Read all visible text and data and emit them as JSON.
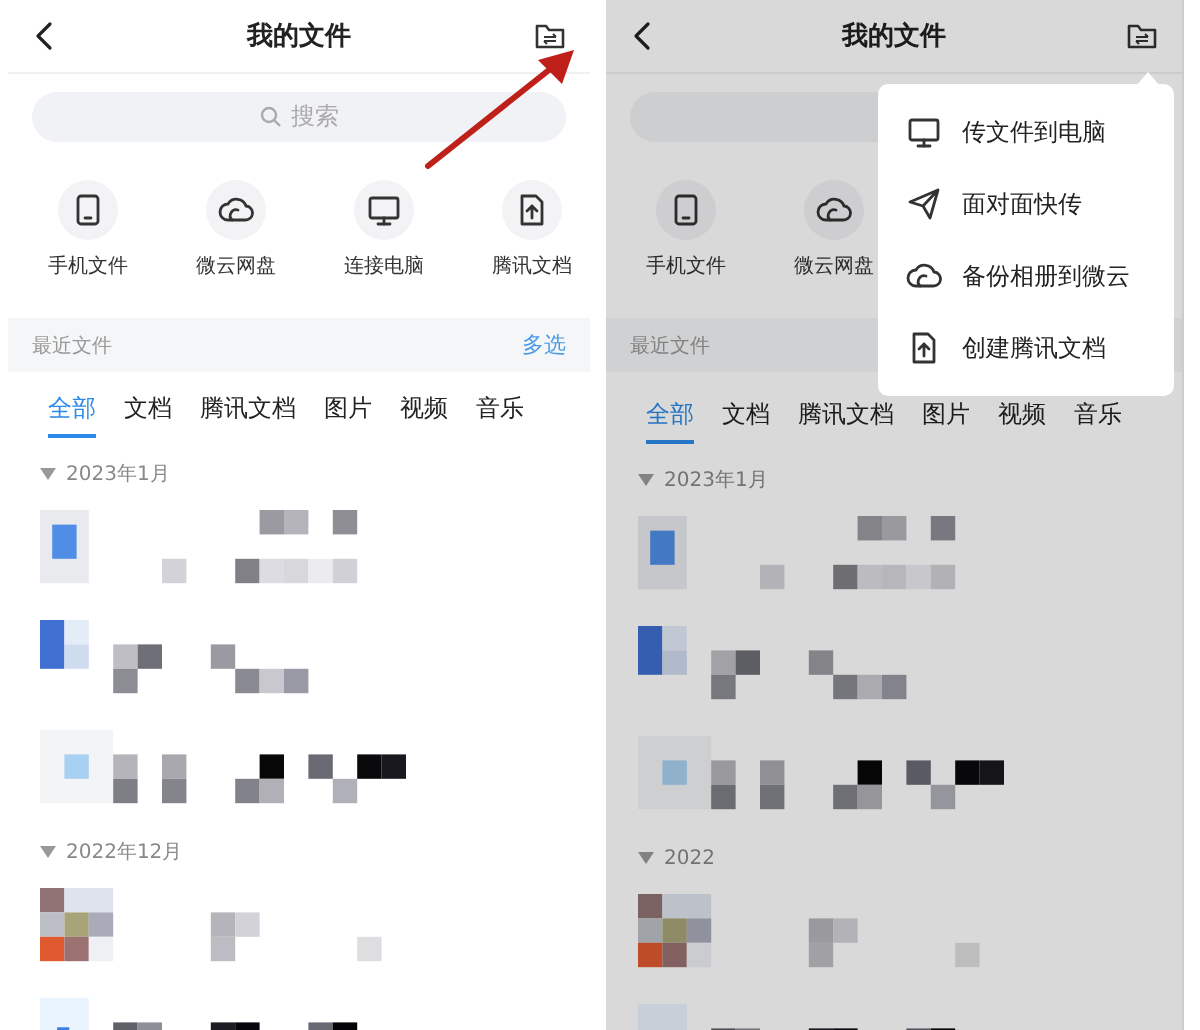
{
  "screens": [
    {
      "title": "我的文件",
      "dimmed": false,
      "search": {
        "placeholder": "搜索"
      },
      "shortcuts": [
        {
          "kind": "phone",
          "label": "手机文件"
        },
        {
          "kind": "cloud",
          "label": "微云网盘"
        },
        {
          "kind": "monitor",
          "label": "连接电脑"
        },
        {
          "kind": "doc",
          "label": "腾讯文档"
        }
      ],
      "section": {
        "title": "最近文件",
        "action": "多选"
      },
      "tabs": [
        {
          "label": "全部",
          "selected": true
        },
        {
          "label": "文档",
          "selected": false
        },
        {
          "label": "腾讯文档",
          "selected": false
        },
        {
          "label": "图片",
          "selected": false
        },
        {
          "label": "视频",
          "selected": false
        },
        {
          "label": "音乐",
          "selected": false
        }
      ],
      "groups": [
        {
          "label": "2023年1月",
          "expanded": true
        },
        {
          "label": "2022年12月",
          "expanded": true
        }
      ]
    },
    {
      "title": "我的文件",
      "dimmed": true,
      "shortcuts": [
        {
          "kind": "phone",
          "label": "手机文件"
        },
        {
          "kind": "cloud",
          "label": "微云网盘"
        }
      ],
      "section": {
        "title": "最近文件"
      },
      "tabs": [
        {
          "label": "全部",
          "selected": true
        },
        {
          "label": "文档",
          "selected": false
        },
        {
          "label": "腾讯文档",
          "selected": false
        },
        {
          "label": "图片",
          "selected": false
        },
        {
          "label": "视频",
          "selected": false
        },
        {
          "label": "音乐",
          "selected": false
        }
      ],
      "groups": [
        {
          "label": "2023年1月",
          "expanded": true
        },
        {
          "label": "2022",
          "expanded": true
        }
      ],
      "menu": [
        {
          "kind": "monitor",
          "label": "传文件到电脑"
        },
        {
          "kind": "send",
          "label": "面对面快传"
        },
        {
          "kind": "cloud",
          "label": "备份相册到微云"
        },
        {
          "kind": "doc",
          "label": "创建腾讯文档"
        }
      ]
    }
  ]
}
